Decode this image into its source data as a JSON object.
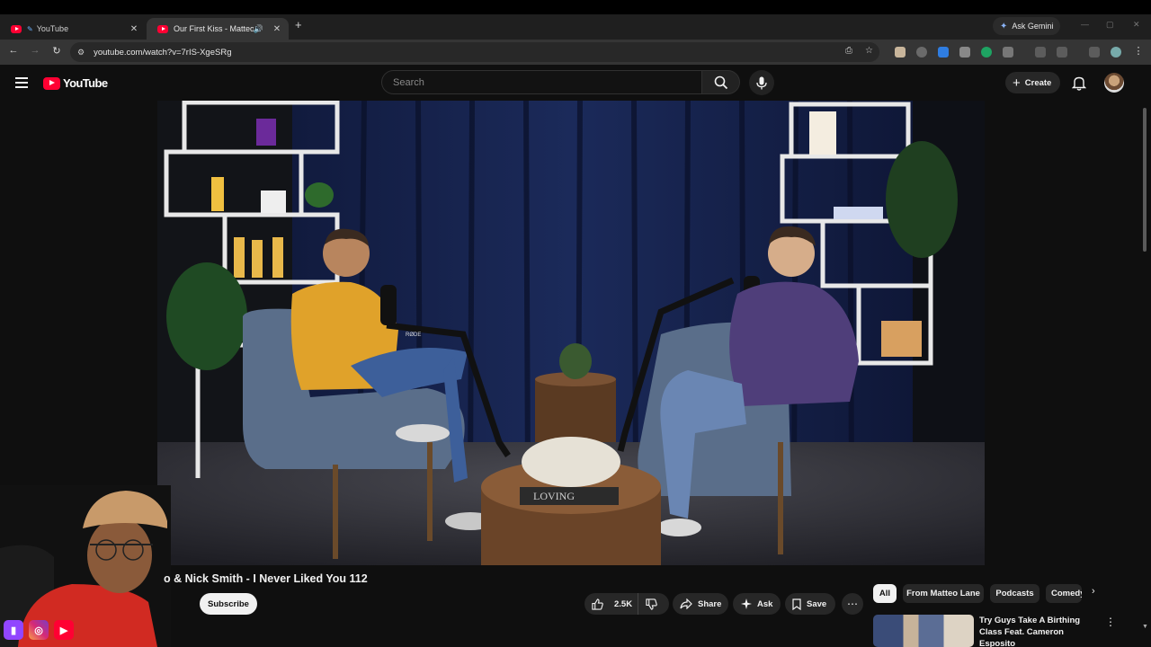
{
  "browser": {
    "tabs": [
      {
        "title": "YouTube"
      },
      {
        "title": "Our First Kiss - Matteo Lane"
      }
    ],
    "ask_gemini": "Ask Gemini",
    "url": "youtube.com/watch?v=7rIS-XgeSRg"
  },
  "youtube": {
    "logo_text": "YouTube",
    "search_placeholder": "Search",
    "create_label": "Create"
  },
  "video": {
    "title_visible": "o & Nick Smith - I Never Liked You 112",
    "subscribe_label": "Subscribe",
    "like_count": "2.5K",
    "share_label": "Share",
    "ask_label": "Ask",
    "save_label": "Save",
    "scene_text": {
      "mic_brand": "RØDE",
      "book": "LOVING"
    }
  },
  "sidebar": {
    "chips": [
      "All",
      "From Matteo Lane",
      "Podcasts",
      "Comedy"
    ],
    "recommendations": [
      {
        "title": "Try Guys Take A Birthing Class Feat. Cameron Esposito"
      }
    ]
  },
  "colors": {
    "yt_red": "#ff0033",
    "bg": "#0f0f0f",
    "chip_bg": "#272727",
    "curtain": "#16224a"
  }
}
